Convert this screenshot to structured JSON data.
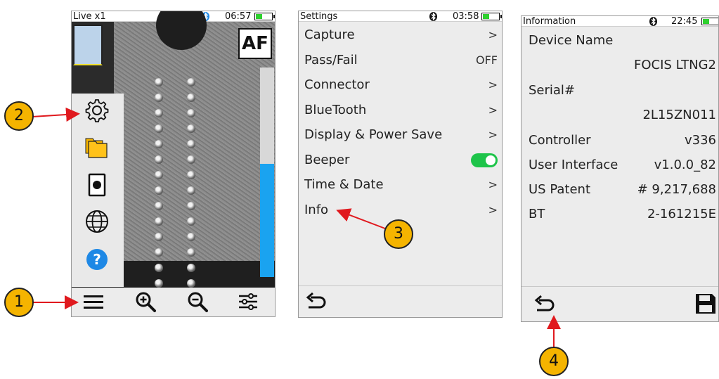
{
  "colors": {
    "accent_blue": "#1aa3f0",
    "toggle_green": "#1ec44a",
    "callout": "#f5b400",
    "arrow": "#e0191e"
  },
  "screen1": {
    "status_title": "Live x1",
    "time": "06:57",
    "af_label": "AF",
    "focus_level": 0.54,
    "side_menu": [
      "gear-icon",
      "folders-icon",
      "record-icon",
      "globe-icon",
      "help-icon"
    ],
    "help_glyph": "?",
    "bottom_bar": [
      "menu-icon",
      "zoom-in-icon",
      "zoom-out-icon",
      "sliders-icon"
    ]
  },
  "screen2": {
    "status_title": "Settings",
    "time": "03:58",
    "items": [
      {
        "label": "Capture",
        "value": ">"
      },
      {
        "label": "Pass/Fail",
        "value": "OFF"
      },
      {
        "label": "Connector",
        "value": ">"
      },
      {
        "label": "BlueTooth",
        "value": ">"
      },
      {
        "label": "Display & Power Save",
        "value": ">"
      },
      {
        "label": "Beeper",
        "toggle": true
      },
      {
        "label": "Time & Date",
        "value": ">"
      },
      {
        "label": "Info",
        "value": ">"
      }
    ]
  },
  "screen3": {
    "status_title": "Information",
    "time": "22:45",
    "device_name_label": "Device Name",
    "device_name_value": "FOCIS LTNG2",
    "serial_label": "Serial#",
    "serial_value": "2L15ZN011",
    "controller_label": "Controller",
    "controller_value": "v336",
    "ui_label": "User Interface",
    "ui_value": "v1.0.0_82",
    "patent_label": "US Patent",
    "patent_value": "# 9,217,688",
    "bt_label": "BT",
    "bt_value": "2-161215E"
  },
  "callouts": [
    "1",
    "2",
    "3",
    "4"
  ]
}
